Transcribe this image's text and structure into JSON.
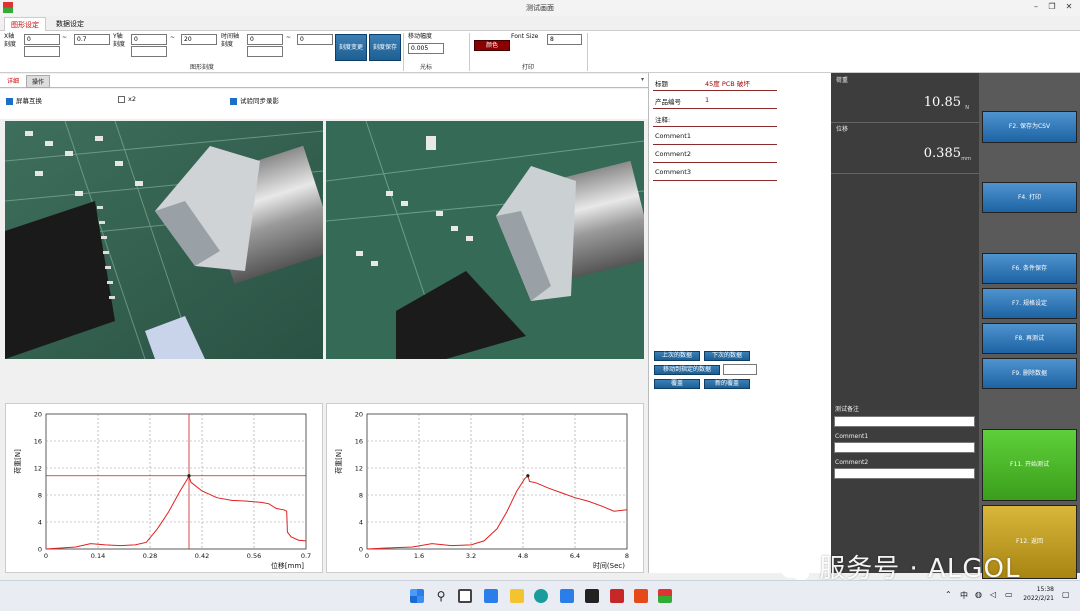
{
  "window": {
    "title": "测试画面"
  },
  "tabs": {
    "graph_settings": "图形设定",
    "data_settings": "数据设定"
  },
  "ribbon": {
    "x_axis_label": "X轴\n刻度",
    "x_min": "0",
    "x_max": "0.7",
    "y_axis_label": "Y轴\n刻度",
    "y_min": "0",
    "y_max": "20",
    "time_axis_label": "时间轴\n刻度",
    "t_min": "0",
    "t_max": "0",
    "tilde": "~",
    "scale_change_btn": "刻度变更",
    "scale_save_btn": "刻度保存",
    "graph_scale_group": "图形刻度",
    "move_step_label": "移动幅度",
    "move_step_value": "0.005",
    "cursor_group": "光标",
    "color_btn": "颜色",
    "font_size_label": "Font Size",
    "font_size_value": "8",
    "print_group": "打印"
  },
  "subtabs": {
    "detail": "详细",
    "operate": "操作"
  },
  "options": {
    "swap_screen": "屏幕互换",
    "x2": "x2",
    "sync_record": "试验同步录影"
  },
  "chart_data": [
    {
      "type": "line",
      "xlabel": "位移[mm]",
      "ylabel": "荷重[N]",
      "xlim": [
        0,
        0.7
      ],
      "ylim": [
        0,
        20
      ],
      "xticks": [
        "0",
        "0.14",
        "0.28",
        "0.42",
        "0.56",
        "0.7"
      ],
      "yticks": [
        "0",
        "4",
        "8",
        "12",
        "16",
        "20"
      ],
      "grid": true,
      "cursor": {
        "x": 0.385,
        "y": 10.85
      },
      "series": [
        {
          "color": "#e02020",
          "x": [
            0,
            0.08,
            0.12,
            0.16,
            0.2,
            0.24,
            0.27,
            0.3,
            0.33,
            0.36,
            0.38,
            0.385,
            0.39,
            0.42,
            0.46,
            0.5,
            0.54,
            0.58,
            0.6,
            0.62,
            0.64,
            0.648,
            0.65,
            0.66,
            0.68,
            0.7
          ],
          "y": [
            0,
            0.3,
            0.8,
            0.6,
            0.5,
            0.6,
            1.0,
            3.0,
            5.5,
            8.5,
            10.3,
            10.85,
            9.9,
            8.6,
            7.6,
            7.2,
            7.1,
            6.9,
            6.7,
            6.0,
            5.8,
            5.6,
            2.5,
            1.8,
            1.3,
            1.2
          ]
        }
      ]
    },
    {
      "type": "line",
      "xlabel": "时间(Sec)",
      "ylabel": "荷重[N]",
      "xlim": [
        0,
        8
      ],
      "ylim": [
        0,
        20
      ],
      "xticks": [
        "0",
        "1.6",
        "3.2",
        "4.8",
        "6.4",
        "8"
      ],
      "yticks": [
        "0",
        "4",
        "8",
        "12",
        "16",
        "20"
      ],
      "grid": true,
      "series": [
        {
          "color": "#e02020",
          "x": [
            0,
            0.8,
            1.4,
            2.0,
            2.6,
            3.2,
            3.6,
            4.0,
            4.3,
            4.6,
            4.85,
            4.95,
            5.0,
            5.2,
            5.6,
            6.0,
            6.4,
            6.8,
            7.2,
            7.6,
            8.0
          ],
          "y": [
            0,
            0.2,
            0.3,
            0.8,
            0.5,
            0.6,
            1.2,
            3.0,
            5.5,
            8.5,
            10.4,
            10.85,
            10.0,
            9.8,
            9.0,
            8.3,
            7.6,
            7.1,
            6.4,
            5.6,
            5.8
          ]
        }
      ]
    }
  ],
  "info": {
    "title_label": "标题",
    "title_value": "45度 PCB 破坏",
    "product_label": "产品编号",
    "product_value": "1",
    "note_label": "注释:",
    "comment1": "Comment1",
    "comment2": "Comment2",
    "comment3": "Comment3"
  },
  "nav": {
    "prev": "上次的数据",
    "next": "下次的数据",
    "move_to": "移动到指定的数据",
    "overwrite": "覆盖",
    "new_overwrite": "新的覆盖"
  },
  "readout": {
    "load_label": "荷重",
    "load_value": "10.85",
    "load_unit": "N",
    "disp_label": "位移",
    "disp_value": "0.385",
    "disp_unit": "mm",
    "test_note_label": "测试备注",
    "comment1_label": "Comment1",
    "comment2_label": "Comment2"
  },
  "fkeys": {
    "f2": "F2. 保存为CSV",
    "f4": "F4. 打印",
    "f6": "F6. 条件保存",
    "f7": "F7. 规格设定",
    "f8": "F8. 再测试",
    "f9": "F9. 删除数据",
    "f11": "F11. 开始测试",
    "f12": "F12. 返回"
  },
  "taskbar": {
    "lang": "中",
    "time": "15:38",
    "date": "2022/2/21"
  },
  "watermark": "服务号 · ALGOL"
}
